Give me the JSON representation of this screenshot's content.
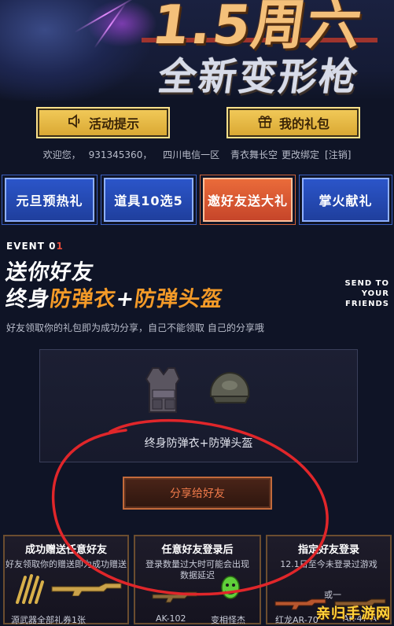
{
  "hero": {
    "title_line1": "1.5周六",
    "title_line2": "全新变形枪"
  },
  "top_buttons": [
    {
      "label": "活动提示",
      "icon": "speaker-icon"
    },
    {
      "label": "我的礼包",
      "icon": "gift-icon"
    }
  ],
  "welcome": {
    "greeting": "欢迎您，",
    "user_id": "931345360，",
    "server": "四川电信一区",
    "role": "青衣舞长空",
    "change_binding": "更改绑定",
    "logout": "[注销]"
  },
  "tabs": [
    {
      "label": "元旦预热礼",
      "active": false
    },
    {
      "label": "道具10选5",
      "active": false
    },
    {
      "label": "邀好友送大礼",
      "active": true
    },
    {
      "label": "掌火献礼",
      "active": false
    }
  ],
  "event": {
    "label": "EVENT 0",
    "label_num": "1",
    "title_line1": "送你好友",
    "title_line2_a": "终身",
    "title_line2_b": "防弹衣",
    "title_line2_c": "+",
    "title_line2_d": "防弹头盔",
    "send_to": [
      "SEND TO",
      "YOUR",
      "FRIENDS"
    ],
    "description": "好友领取你的礼包即为成功分享，自己不能领取 自己的分享哦"
  },
  "reward_panel": {
    "caption": "终身防弹衣+防弹头盔",
    "share_button": "分享给好友"
  },
  "cards": [
    {
      "title": "成功赠送任意好友",
      "sub": "好友领取你的赠送即为成功赠送",
      "items": [
        "源武器全部礼券1张"
      ]
    },
    {
      "title": "任意好友登录后",
      "sub": "登录数量过大时可能会出现数据延迟",
      "items": [
        "AK-102",
        "变相怪杰"
      ]
    },
    {
      "title": "指定好友登录",
      "sub": "12.1日至今未登录过游戏",
      "items": [
        "AK-47-A",
        "红龙AR-70",
        "或一"
      ]
    }
  ],
  "colors": {
    "background": "#0f1426",
    "tab_blue": "#2b55c9",
    "tab_active": "#ea6b3a",
    "gold_button": "#f2ca5a",
    "accent_orange": "#f39a28",
    "annotation_red": "#e0262a"
  },
  "watermark": {
    "text": "亲归手游网"
  }
}
